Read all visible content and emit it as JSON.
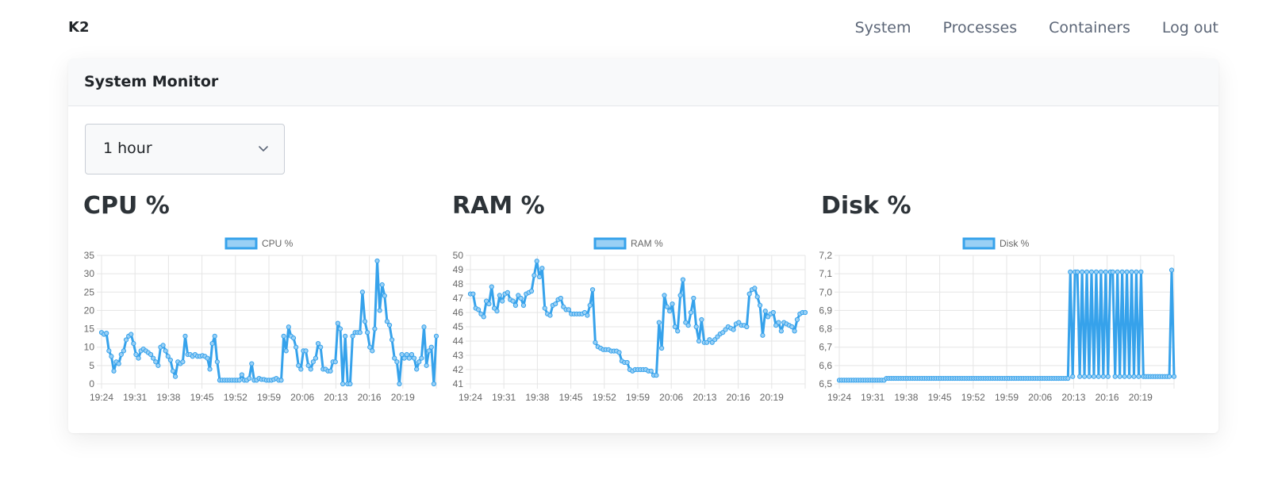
{
  "navbar": {
    "brand": "K2",
    "links": [
      {
        "label": "System"
      },
      {
        "label": "Processes"
      },
      {
        "label": "Containers"
      },
      {
        "label": "Log out"
      }
    ]
  },
  "card": {
    "title": "System Monitor"
  },
  "range_select": {
    "value": "1 hour",
    "icon": "chevron-down-icon"
  },
  "colors": {
    "series_line": "#36a2eb",
    "series_fill": "#9ad0f5",
    "grid": "#e5e5e5",
    "tick_text": "#666666"
  },
  "chart_data": [
    {
      "type": "line",
      "title": "CPU %",
      "legend": "CPU %",
      "legend_position": "top",
      "grid": true,
      "x_tick_labels": [
        "19:24",
        "19:31",
        "19:38",
        "19:45",
        "19:52",
        "19:59",
        "20:06",
        "20:13",
        "20:16",
        "20:19"
      ],
      "ylim": [
        0,
        35
      ],
      "y_ticks": [
        "0",
        "5",
        "10",
        "15",
        "20",
        "25",
        "30",
        "35"
      ],
      "series": [
        {
          "name": "CPU %",
          "values": [
            14,
            13.5,
            13.8,
            9,
            7.5,
            3.5,
            6,
            5.5,
            8,
            9,
            12,
            13,
            13.5,
            11,
            8,
            7,
            9,
            9.5,
            9,
            8.5,
            8,
            7,
            6,
            5,
            10,
            10.5,
            9,
            7.5,
            6.5,
            3.5,
            2,
            6,
            5.5,
            6,
            13,
            8,
            8,
            7.5,
            8,
            7.5,
            7.5,
            7.7,
            7.5,
            7,
            4,
            11,
            13,
            6,
            1,
            1,
            1,
            1,
            1,
            1,
            1,
            1,
            1,
            2.5,
            1,
            1,
            1.5,
            5.5,
            1,
            1,
            1.5,
            1.2,
            1.2,
            1,
            1,
            1,
            1.2,
            1.5,
            1,
            1,
            13,
            9,
            15.5,
            13,
            12.5,
            10,
            5,
            4,
            9,
            9,
            5,
            4,
            6,
            7,
            11,
            10,
            4,
            4,
            3.5,
            3.5,
            6,
            6,
            16.5,
            15,
            0,
            13,
            0,
            0,
            13,
            14,
            14,
            14,
            25,
            17,
            14,
            10,
            9,
            15,
            33.5,
            20,
            27,
            24,
            17,
            16,
            12,
            7,
            6,
            0,
            8,
            7,
            8,
            7,
            8,
            7,
            4,
            6,
            7,
            15.5,
            5,
            9,
            10,
            0,
            13
          ]
        }
      ]
    },
    {
      "type": "line",
      "title": "RAM %",
      "legend": "RAM %",
      "legend_position": "top",
      "grid": true,
      "x_tick_labels": [
        "19:24",
        "19:31",
        "19:38",
        "19:45",
        "19:52",
        "19:59",
        "20:06",
        "20:13",
        "20:16",
        "20:19"
      ],
      "ylim": [
        41,
        50
      ],
      "y_ticks": [
        "41",
        "42",
        "43",
        "44",
        "45",
        "46",
        "47",
        "48",
        "49",
        "50"
      ],
      "series": [
        {
          "name": "RAM %",
          "values": [
            47.3,
            47.3,
            46.3,
            46.2,
            45.9,
            45.7,
            46.8,
            46.6,
            47.8,
            46.3,
            46.1,
            47.2,
            46.8,
            47.3,
            47.4,
            46.9,
            46.8,
            46.5,
            47.2,
            47,
            46.5,
            47.3,
            47.4,
            47.5,
            48.6,
            49.6,
            48.5,
            49.1,
            46.3,
            45.9,
            45.8,
            46.5,
            46.6,
            46.9,
            47,
            46.4,
            46.2,
            46.2,
            45.9,
            45.9,
            45.9,
            45.9,
            45.9,
            46,
            45.8,
            46.5,
            47.6,
            43.9,
            43.6,
            43.5,
            43.4,
            43.4,
            43.4,
            43.3,
            43.3,
            43.3,
            43.2,
            42.6,
            42.5,
            42.5,
            42,
            41.9,
            42,
            42,
            42,
            42,
            42,
            41.9,
            41.9,
            41.6,
            41.6,
            45.3,
            43.5,
            47.2,
            46.4,
            46.1,
            46.6,
            45,
            44.7,
            47.2,
            48.3,
            45.3,
            45.1,
            46,
            47,
            45,
            44,
            45.5,
            43.9,
            43.9,
            44.1,
            43.9,
            44.1,
            44.3,
            44.5,
            44.6,
            44.8,
            45,
            44.9,
            44.8,
            45.2,
            45.3,
            45.1,
            45.1,
            45,
            47.3,
            47.6,
            47.7,
            47.1,
            46.5,
            44.4,
            46.1,
            45.7,
            45.9,
            46,
            45.1,
            45.3,
            44.7,
            45.3,
            45.2,
            45.1,
            45,
            44.7,
            45.5,
            45.9,
            46,
            46
          ]
        }
      ]
    },
    {
      "type": "line",
      "title": "Disk %",
      "legend": "Disk %",
      "legend_position": "top",
      "grid": true,
      "x_tick_labels": [
        "19:24",
        "19:31",
        "19:38",
        "19:45",
        "19:52",
        "19:59",
        "20:06",
        "20:13",
        "20:16",
        "20:19"
      ],
      "ylim": [
        6.5,
        7.2
      ],
      "y_ticks": [
        "6,5",
        "6,6",
        "6,7",
        "6,8",
        "6,9",
        "7,0",
        "7,1",
        "7,2"
      ],
      "series": [
        {
          "name": "Disk %",
          "values": [
            6.52,
            6.52,
            6.52,
            6.52,
            6.52,
            6.52,
            6.52,
            6.52,
            6.52,
            6.52,
            6.52,
            6.52,
            6.52,
            6.52,
            6.52,
            6.52,
            6.52,
            6.52,
            6.52,
            6.52,
            6.53,
            6.53,
            6.53,
            6.53,
            6.53,
            6.53,
            6.53,
            6.53,
            6.53,
            6.53,
            6.53,
            6.53,
            6.53,
            6.53,
            6.53,
            6.53,
            6.53,
            6.53,
            6.53,
            6.53,
            6.53,
            6.53,
            6.53,
            6.53,
            6.53,
            6.53,
            6.53,
            6.53,
            6.53,
            6.53,
            6.53,
            6.53,
            6.53,
            6.53,
            6.53,
            6.53,
            6.53,
            6.53,
            6.53,
            6.53,
            6.53,
            6.53,
            6.53,
            6.53,
            6.53,
            6.53,
            6.53,
            6.53,
            6.53,
            6.53,
            6.53,
            6.53,
            6.53,
            6.53,
            6.53,
            6.53,
            6.53,
            6.53,
            6.53,
            6.53,
            6.53,
            6.53,
            6.53,
            6.53,
            6.53,
            6.53,
            6.53,
            6.53,
            6.53,
            6.53,
            6.53,
            6.53,
            6.53,
            6.53,
            6.53,
            6.53,
            6.53,
            6.53,
            7.11,
            6.54,
            7.11,
            7.11,
            6.54,
            7.11,
            6.54,
            7.11,
            6.54,
            7.11,
            6.54,
            7.11,
            6.54,
            7.11,
            6.54,
            7.11,
            6.54,
            7.11,
            7.11,
            6.54,
            7.11,
            6.54,
            7.11,
            6.54,
            7.11,
            6.54,
            7.11,
            6.54,
            7.11,
            6.54,
            7.11,
            6.54,
            6.54,
            6.54,
            6.54,
            6.54,
            6.54,
            6.54,
            6.54,
            6.54,
            6.54,
            6.54,
            6.54,
            7.12,
            6.54
          ]
        }
      ]
    }
  ]
}
